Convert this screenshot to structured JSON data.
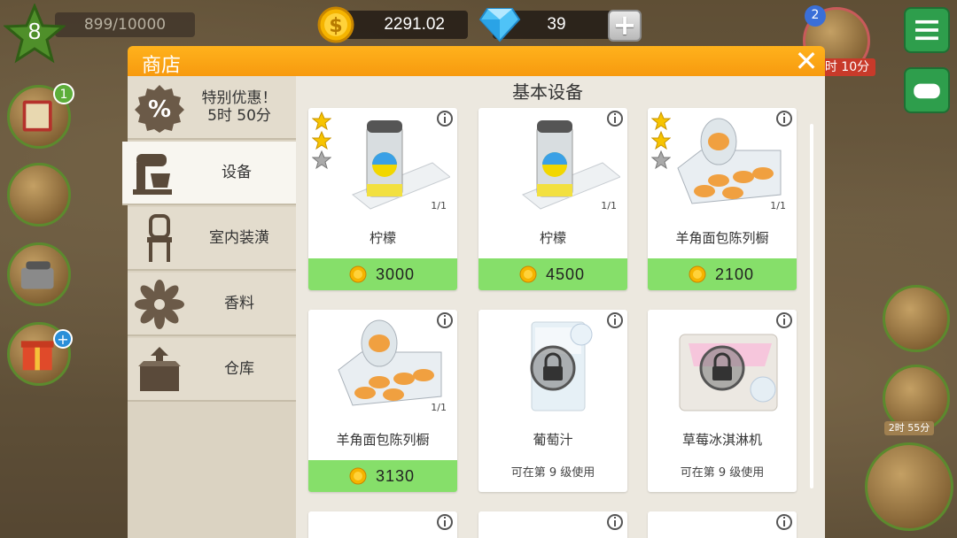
{
  "hud": {
    "level": "8",
    "xp": "899/10000",
    "coins": "2291.02",
    "gems": "39",
    "plus": "+"
  },
  "shop": {
    "title": "商店",
    "close": "✕",
    "section_title": "基本设备",
    "sidebar": [
      {
        "label": "特别优惠！\n5时 50分",
        "icon": "percent-icon"
      },
      {
        "label": "设备",
        "icon": "mixer-icon"
      },
      {
        "label": "室内装潢",
        "icon": "chair-icon"
      },
      {
        "label": "香料",
        "icon": "star-anise-icon"
      },
      {
        "label": "仓库",
        "icon": "storage-box-icon"
      }
    ],
    "items": [
      {
        "name": "柠檬",
        "stock": "1/1",
        "price": "3000",
        "stars": 2,
        "art": "lemonade-dispenser"
      },
      {
        "name": "柠檬",
        "stock": "1/1",
        "price": "4500",
        "stars": 0,
        "art": "lemonade-dispenser"
      },
      {
        "name": "羊角面包陈列橱",
        "stock": "1/1",
        "price": "2100",
        "stars": 2,
        "art": "croissant-display"
      },
      {
        "name": "羊角面包陈列橱",
        "stock": "1/1",
        "price": "3130",
        "stars": 0,
        "art": "croissant-display"
      },
      {
        "name": "葡萄汁",
        "unlock": "可在第 9 级使用",
        "art": "grape-juice-machine",
        "locked": true
      },
      {
        "name": "草莓冰淇淋机",
        "unlock": "可在第 9 级使用",
        "art": "ice-cream-machine",
        "locked": true
      }
    ]
  },
  "right_hud": {
    "timer1": "时 10分",
    "timer2": "2时 55分",
    "badge": "2"
  },
  "left_hud": {
    "badge": "1",
    "plus_badge": "+"
  }
}
